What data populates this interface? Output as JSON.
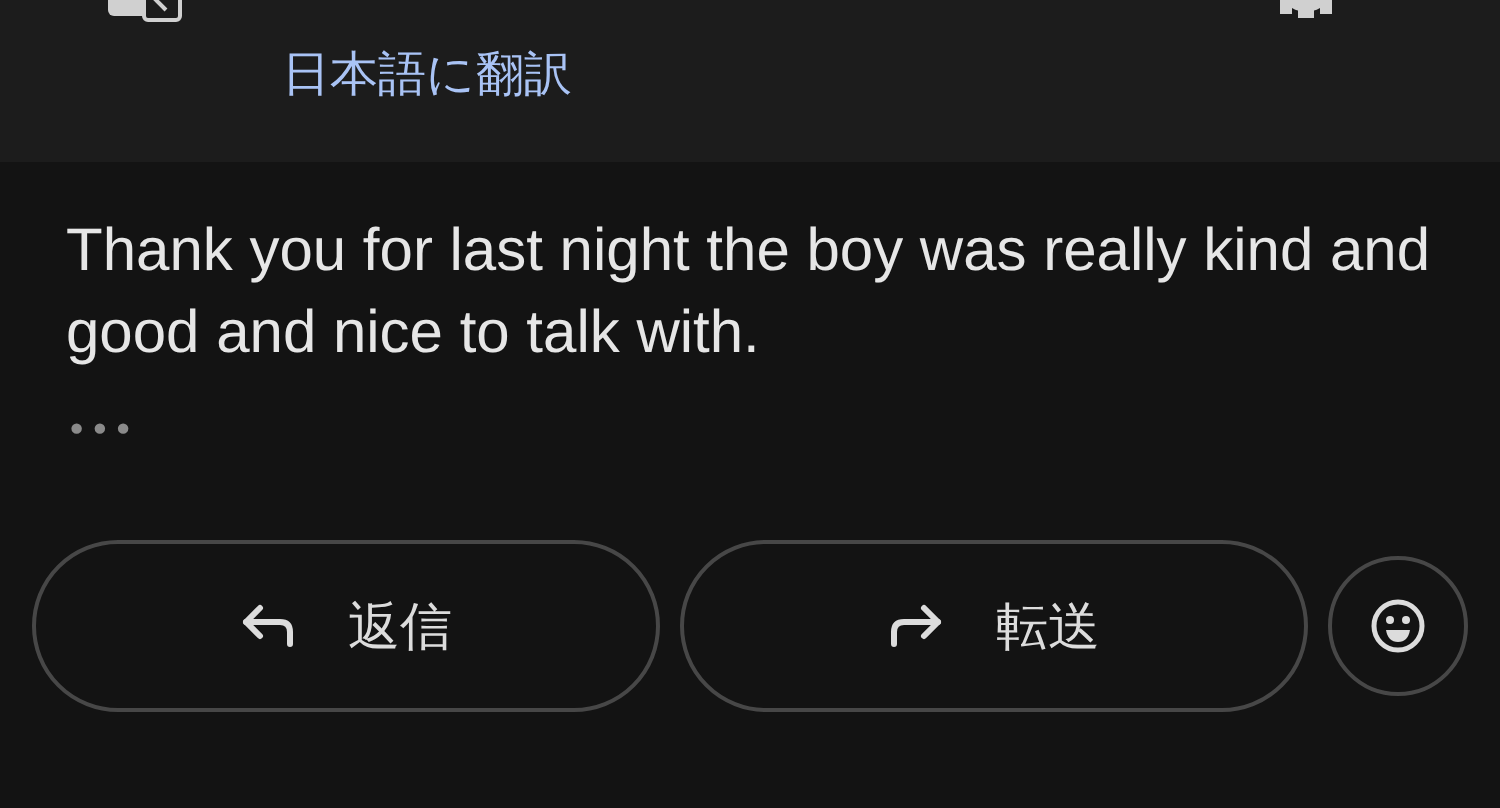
{
  "header": {
    "translate_link": "日本語に翻訳"
  },
  "message": {
    "body": "Thank you for last night the boy was really kind and good and nice to talk with.",
    "more": "•••"
  },
  "actions": [
    {
      "kind": "reply",
      "label": "返信"
    },
    {
      "kind": "forward",
      "label": "転送"
    },
    {
      "kind": "emoji"
    }
  ]
}
